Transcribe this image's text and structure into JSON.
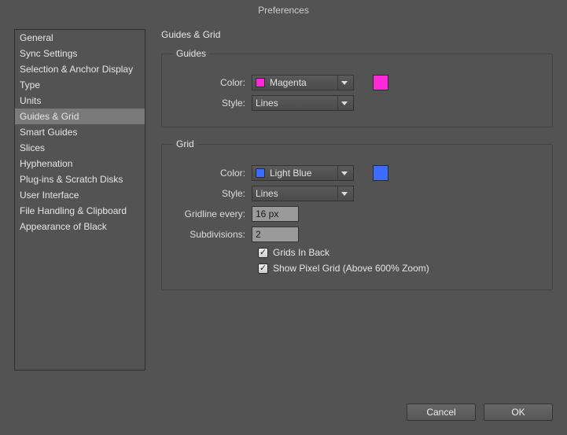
{
  "window": {
    "title": "Preferences"
  },
  "sidebar": {
    "selectedIndex": 5,
    "items": [
      {
        "label": "General"
      },
      {
        "label": "Sync Settings"
      },
      {
        "label": "Selection & Anchor Display"
      },
      {
        "label": "Type"
      },
      {
        "label": "Units"
      },
      {
        "label": "Guides & Grid"
      },
      {
        "label": "Smart Guides"
      },
      {
        "label": "Slices"
      },
      {
        "label": "Hyphenation"
      },
      {
        "label": "Plug-ins & Scratch Disks"
      },
      {
        "label": "User Interface"
      },
      {
        "label": "File Handling & Clipboard"
      },
      {
        "label": "Appearance of Black"
      }
    ]
  },
  "panel": {
    "title": "Guides & Grid",
    "guides": {
      "legend": "Guides",
      "colorLabel": "Color:",
      "colorName": "Magenta",
      "colorHex": "#ff29d9",
      "styleLabel": "Style:",
      "styleValue": "Lines"
    },
    "grid": {
      "legend": "Grid",
      "colorLabel": "Color:",
      "colorName": "Light Blue",
      "colorHex": "#3b6cff",
      "styleLabel": "Style:",
      "styleValue": "Lines",
      "gridlineLabel": "Gridline every:",
      "gridlineValue": "16 px",
      "subdivLabel": "Subdivisions:",
      "subdivValue": "2",
      "gridsInBack": {
        "label": "Grids In Back",
        "checked": true
      },
      "showPixelGrid": {
        "label": "Show Pixel Grid (Above 600% Zoom)",
        "checked": true
      }
    }
  },
  "buttons": {
    "cancel": "Cancel",
    "ok": "OK"
  }
}
